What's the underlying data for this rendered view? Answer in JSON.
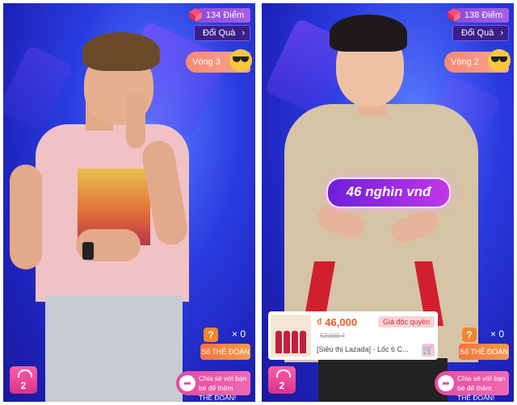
{
  "panels": [
    {
      "points": "134 Điểm",
      "redeem_label": "Đổi Quà",
      "round_label": "Vòng 3",
      "guess_count": "0",
      "guess_button": "Số THẺ ĐOÁN",
      "share_text_1": "Chia sẻ với bạn",
      "share_text_2": "bè để thêm",
      "share_text_3": "THẺ ĐOÁN!",
      "bag_count": "2"
    },
    {
      "points": "138 Điểm",
      "redeem_label": "Đổi Quà",
      "round_label": "Vòng 2",
      "price_guess": "46 nghìn vnđ",
      "product": {
        "price": "₫ 46,000",
        "exclusive": "Giá độc quyền",
        "old_price": "52,000 ₫",
        "name": "[Siêu thị Lazada] - Lốc 6 C..."
      },
      "guess_count": "0",
      "guess_button": "Số THẺ ĐOÁN",
      "share_text_1": "Chia sẻ với bạn",
      "share_text_2": "bè để thêm",
      "share_text_3": "THẺ ĐOÁN!",
      "bag_count": "2"
    }
  ],
  "colors": {
    "background_blue": "#2a3ce0",
    "points_purple": "#8b49d8",
    "round_orange": "#f58a70",
    "share_pink": "#e64a9c",
    "price_orange": "#f05a24"
  }
}
